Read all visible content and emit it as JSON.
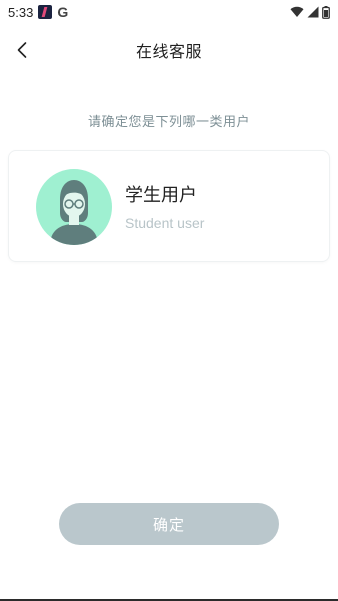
{
  "status_bar": {
    "time": "5:33",
    "google_icon": "G",
    "icons": [
      "notification-app-icon",
      "google-icon",
      "wifi-icon",
      "signal-icon",
      "battery-icon"
    ]
  },
  "header": {
    "back_icon": "chevron-left-icon",
    "title": "在线客服"
  },
  "prompt": "请确定您是下列哪一类用户",
  "user_options": [
    {
      "title": "学生用户",
      "subtitle": "Student user",
      "icon": "student-avatar-icon"
    }
  ],
  "confirm_button": {
    "label": "确定",
    "state": "disabled"
  },
  "colors": {
    "avatar_bg": "#9ff0d1",
    "button_bg": "#bac7cc",
    "prompt_text": "#7d8f95",
    "subtitle_text": "#b8c4c8"
  }
}
